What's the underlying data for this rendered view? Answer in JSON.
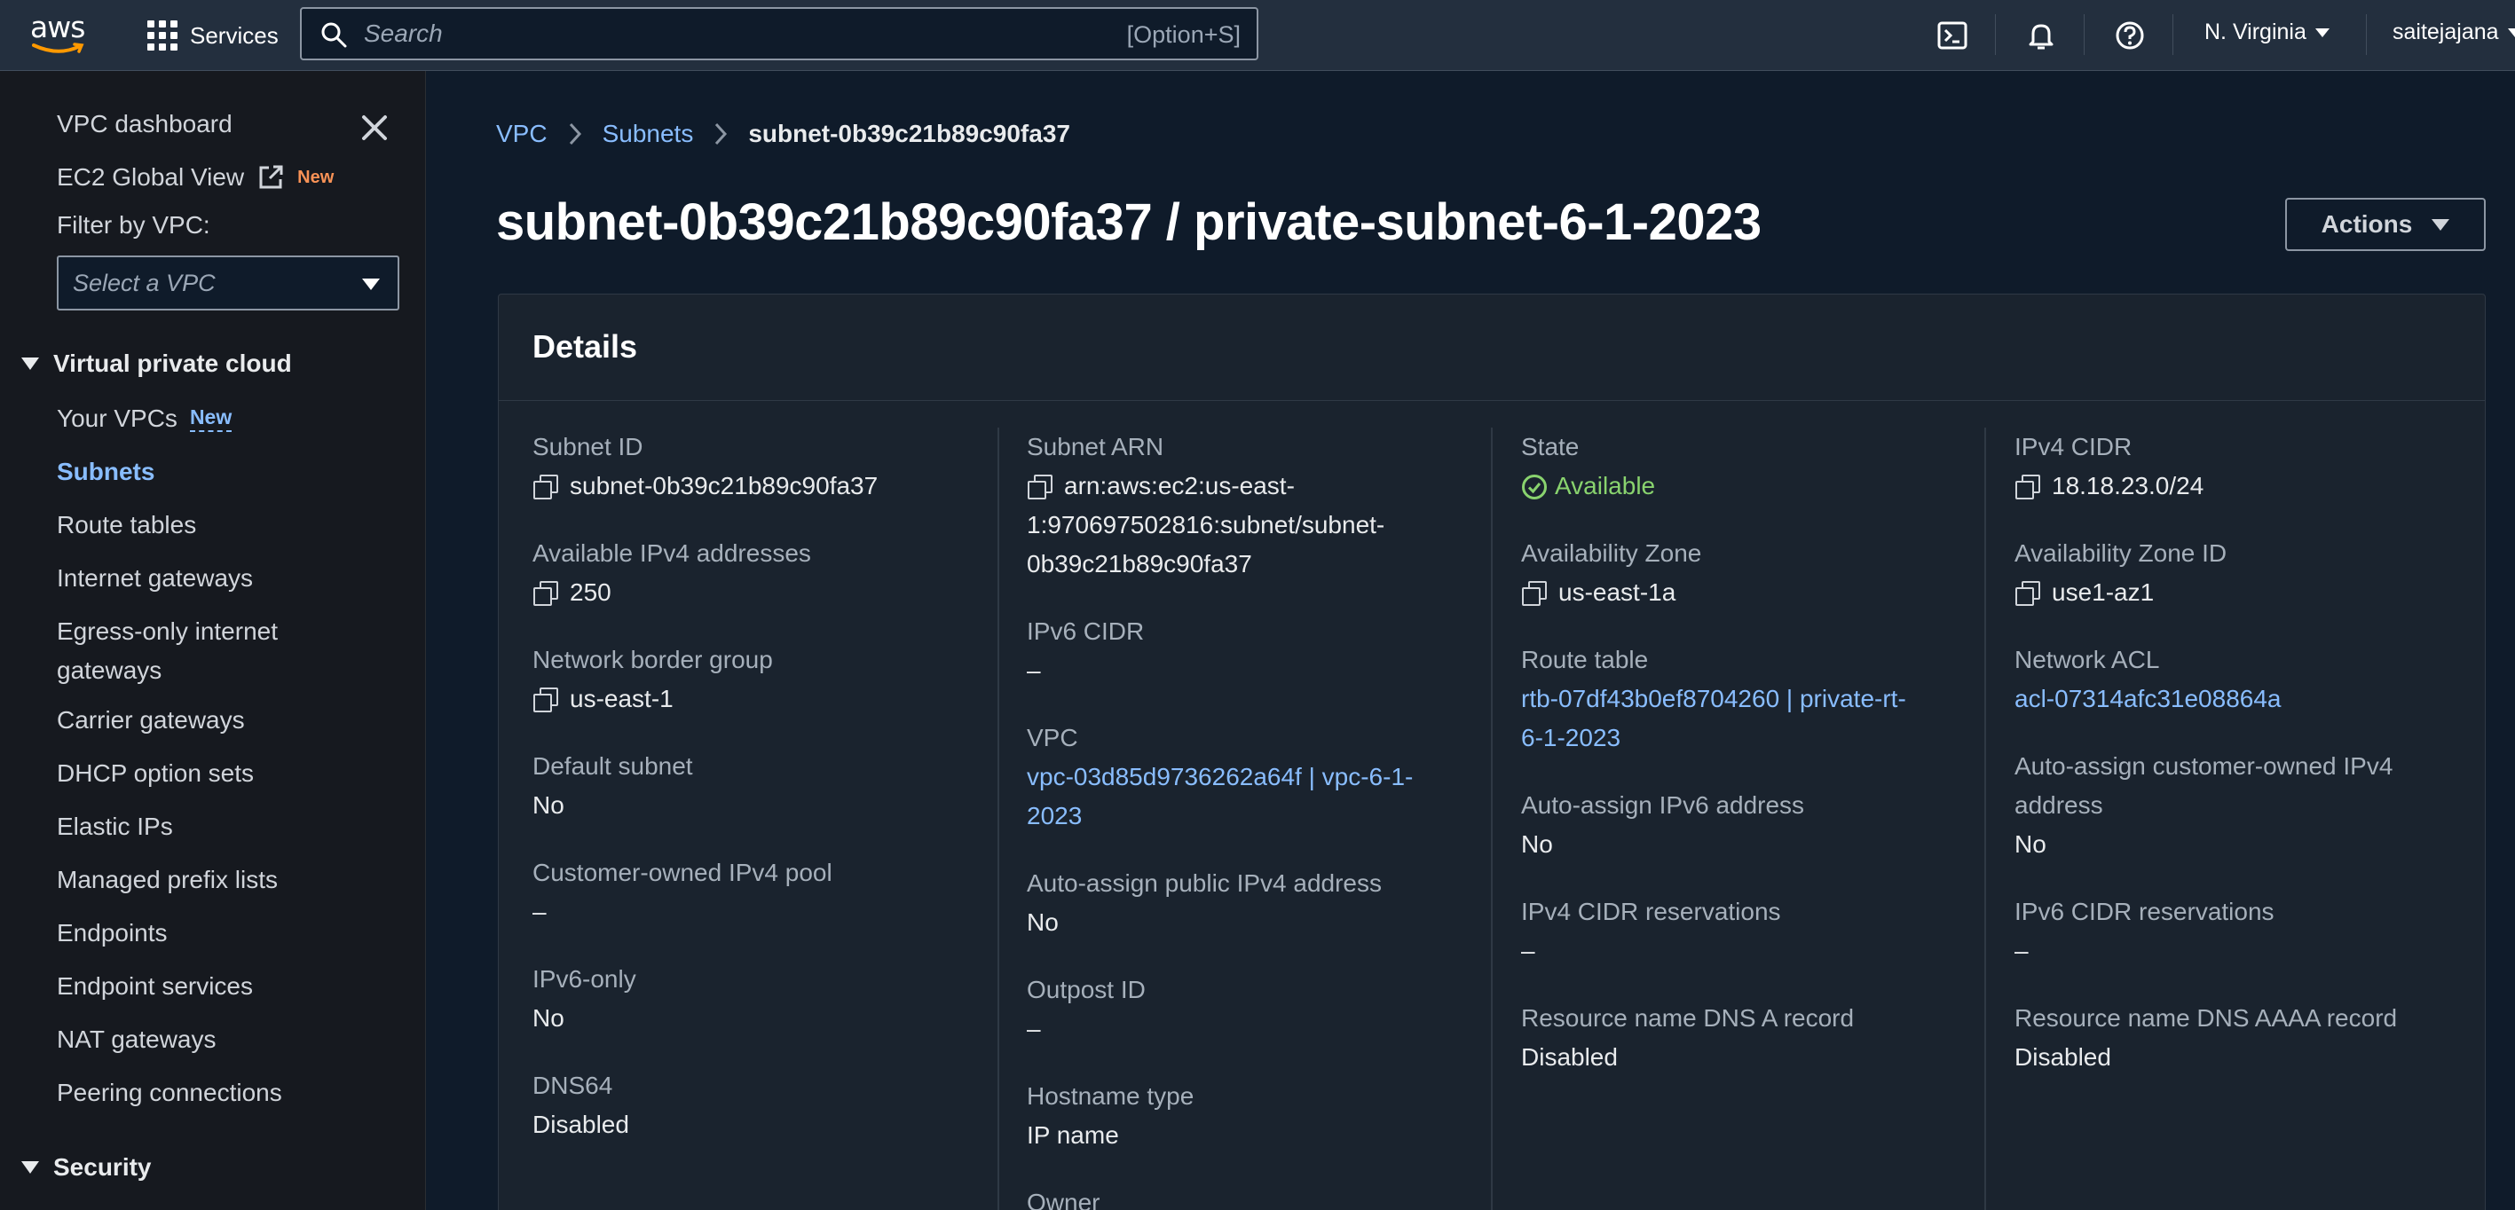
{
  "topnav": {
    "logo_text": "aws",
    "services_label": "Services",
    "search_placeholder": "Search",
    "search_shortcut": "[Option+S]",
    "region": "N. Virginia",
    "user": "saitejajana"
  },
  "sidebar": {
    "dashboard": "VPC dashboard",
    "ec2_global_view": "EC2 Global View",
    "ec2_badge": "New",
    "filter_label": "Filter by VPC:",
    "select_placeholder": "Select a VPC",
    "section_vpc": "Virtual private cloud",
    "items": [
      {
        "label": "Your VPCs",
        "badge": "New"
      },
      {
        "label": "Subnets"
      },
      {
        "label": "Route tables"
      },
      {
        "label": "Internet gateways"
      },
      {
        "label": "Egress-only internet"
      },
      {
        "label": "gateways"
      },
      {
        "label": "Carrier gateways"
      },
      {
        "label": "DHCP option sets"
      },
      {
        "label": "Elastic IPs"
      },
      {
        "label": "Managed prefix lists"
      },
      {
        "label": "Endpoints"
      },
      {
        "label": "Endpoint services"
      },
      {
        "label": "NAT gateways"
      },
      {
        "label": "Peering connections"
      }
    ],
    "section_security": "Security"
  },
  "main": {
    "breadcrumb": [
      "VPC",
      "Subnets",
      "subnet-0b39c21b89c90fa37"
    ],
    "title": "subnet-0b39c21b89c90fa37 / private-subnet-6-1-2023",
    "actions_label": "Actions",
    "details_heading": "Details",
    "columns": [
      [
        {
          "label": "Subnet ID",
          "value": "subnet-0b39c21b89c90fa37"
        },
        {
          "label": "Available IPv4 addresses",
          "value": "250"
        },
        {
          "label": "Network border group",
          "value": "us-east-1"
        },
        {
          "label": "Default subnet",
          "value": "No"
        },
        {
          "label": "Customer-owned IPv4 pool",
          "value": "–"
        },
        {
          "label": "IPv6-only",
          "value": "No"
        },
        {
          "label": "DNS64",
          "value": "Disabled"
        }
      ],
      [
        {
          "label": "Subnet ARN",
          "value_lines": [
            "arn:aws:ec2:us-east-",
            "1:970697502816:subnet/subnet-",
            "0b39c21b89c90fa37"
          ]
        },
        {
          "label": "IPv6 CIDR",
          "value": "–"
        },
        {
          "label": "VPC",
          "value_lines": [
            "vpc-03d85d9736262a64f | vpc-6-1-",
            "2023"
          ]
        },
        {
          "label": "Auto-assign public IPv4 address",
          "value": "No"
        },
        {
          "label": "Outpost ID",
          "value": "–"
        },
        {
          "label": "Hostname type",
          "value": "IP name"
        },
        {
          "label": "Owner"
        }
      ],
      [
        {
          "label": "State",
          "value": "Available"
        },
        {
          "label": "Availability Zone",
          "value": "us-east-1a"
        },
        {
          "label": "Route table",
          "value_lines": [
            "rtb-07df43b0ef8704260 | private-rt-",
            "6-1-2023"
          ]
        },
        {
          "label": "Auto-assign IPv6 address",
          "value": "No"
        },
        {
          "label": "IPv4 CIDR reservations",
          "value": "–"
        },
        {
          "label": "Resource name DNS A record",
          "value": "Disabled"
        }
      ],
      [
        {
          "label": "IPv4 CIDR",
          "value": "18.18.23.0/24"
        },
        {
          "label": "Availability Zone ID",
          "value": "use1-az1"
        },
        {
          "label": "Network ACL",
          "value": "acl-07314afc31e08864a"
        },
        {
          "label_lines": [
            "Auto-assign customer-owned IPv4",
            "address"
          ],
          "value": "No"
        },
        {
          "label": "IPv6 CIDR reservations",
          "value": "–"
        },
        {
          "label": "Resource name DNS AAAA record",
          "value": "Disabled"
        }
      ]
    ]
  },
  "colors": {
    "nav_bg": "#232f3e",
    "sidebar_bg": "#16191f",
    "page_bg": "#0f1b2a",
    "panel_bg": "#1a232e",
    "link": "#89bdff",
    "success": "#89d36e",
    "badge_orange": "#f89256"
  },
  "icons": [
    "aws-logo",
    "services-grid-icon",
    "search-icon",
    "cloudshell-icon",
    "notifications-bell-icon",
    "help-icon",
    "close-icon",
    "external-link-icon",
    "copy-icon",
    "status-available-icon",
    "caret-down-icon",
    "chevron-right-icon"
  ]
}
